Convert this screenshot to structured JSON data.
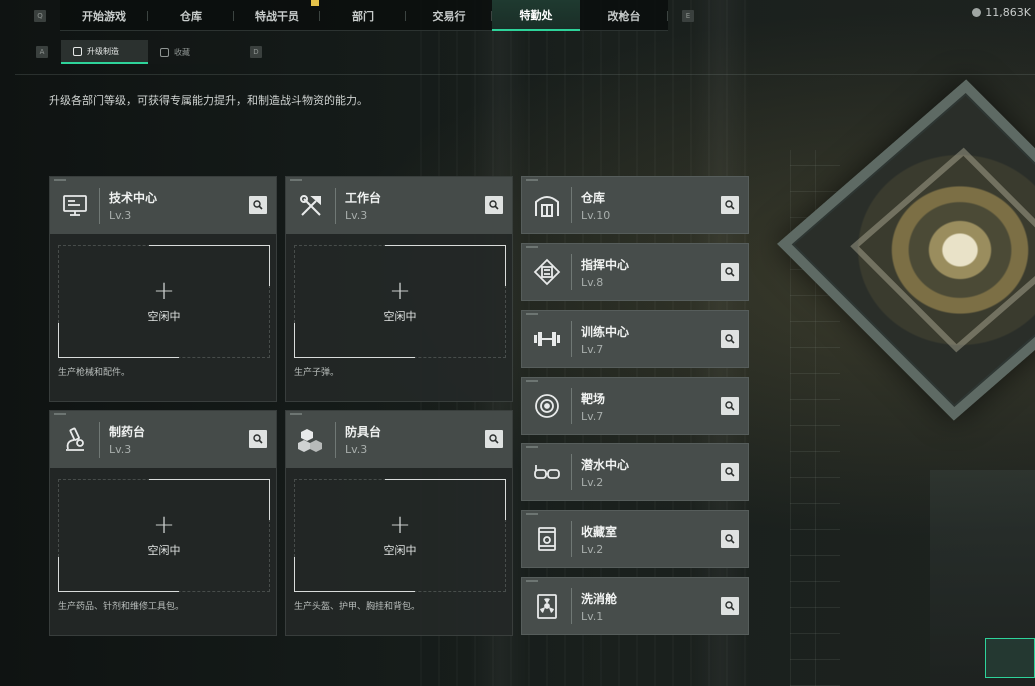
{
  "top_nav": {
    "left_key": "Q",
    "right_key": "E",
    "tabs": [
      "开始游戏",
      "仓库",
      "特战干员",
      "部门",
      "交易行",
      "特勤处",
      "改枪台"
    ],
    "active_index": 5,
    "currency": "11,863K"
  },
  "sub_nav": {
    "left_key": "A",
    "right_key": "D",
    "tabs": [
      "升级制造",
      "收藏"
    ],
    "active_index": 0
  },
  "description": "升级各部门等级，可获得专属能力提升，和制造战斗物资的能力。",
  "production_stations": [
    {
      "name": "技术中心",
      "level": "Lv.3",
      "icon": "monitor-icon",
      "slot_status": "空闲中",
      "plus": "+",
      "footer": "生产枪械和配件。"
    },
    {
      "name": "工作台",
      "level": "Lv.3",
      "icon": "tools-icon",
      "slot_status": "空闲中",
      "plus": "+",
      "footer": "生产子弹。"
    },
    {
      "name": "制药台",
      "level": "Lv.3",
      "icon": "microscope-icon",
      "slot_status": "空闲中",
      "plus": "+",
      "footer": "生产药品、针剂和维修工具包。"
    },
    {
      "name": "防具台",
      "level": "Lv.3",
      "icon": "cubes-icon",
      "slot_status": "空闲中",
      "plus": "+",
      "footer": "生产头盔、护甲、胸挂和背包。"
    }
  ],
  "facilities": [
    {
      "name": "仓库",
      "level": "Lv.10",
      "icon": "warehouse-icon"
    },
    {
      "name": "指挥中心",
      "level": "Lv.8",
      "icon": "chip-icon"
    },
    {
      "name": "训练中心",
      "level": "Lv.7",
      "icon": "dumbbell-icon"
    },
    {
      "name": "靶场",
      "level": "Lv.7",
      "icon": "target-icon"
    },
    {
      "name": "潜水中心",
      "level": "Lv.2",
      "icon": "goggles-icon"
    },
    {
      "name": "收藏室",
      "level": "Lv.2",
      "icon": "display-case-icon"
    },
    {
      "name": "洗消舱",
      "level": "Lv.1",
      "icon": "radiation-chamber-icon"
    }
  ],
  "colors": {
    "accent": "#2ed39a",
    "card_header": "#454b49",
    "card_body": "#242827"
  }
}
